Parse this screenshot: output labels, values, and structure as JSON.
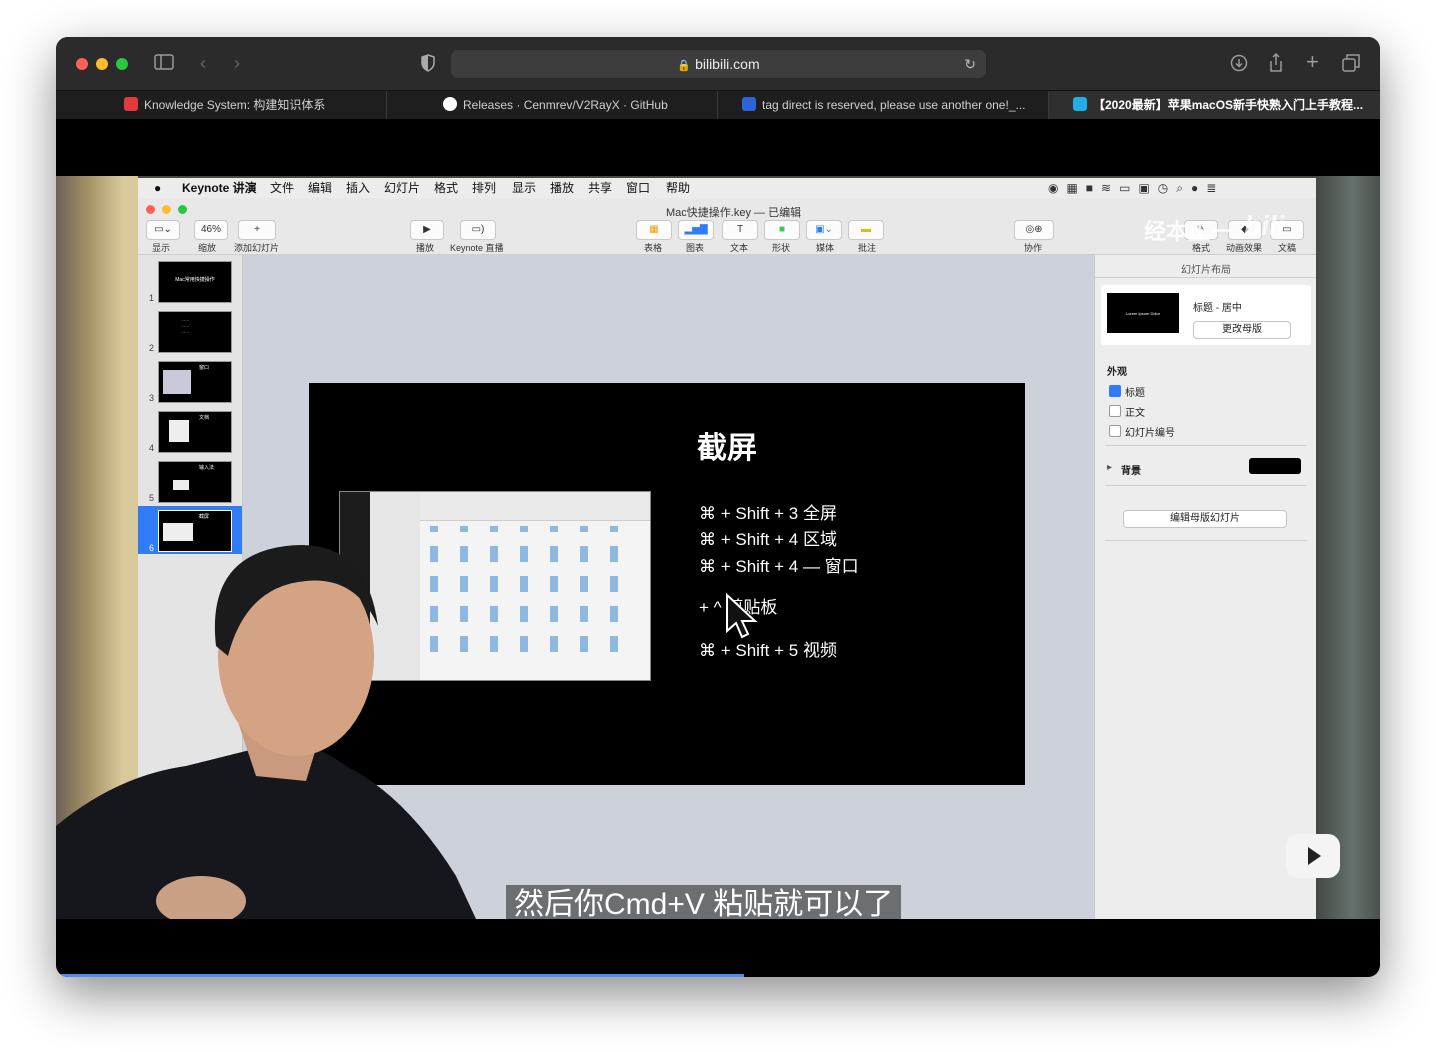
{
  "browser": {
    "url": "bilibili.com",
    "tabs": [
      {
        "label": "Knowledge System: 构建知识体系",
        "favicon_color": "#e23a3a"
      },
      {
        "label": "Releases · Cenmrev/V2RayX · GitHub",
        "favicon_color": "#ffffff"
      },
      {
        "label": "tag direct is reserved, please use another one!_...",
        "favicon_color": "#2f63d8"
      },
      {
        "label": "【2020最新】苹果macOS新手快熟入门上手教程...",
        "favicon_color": "#23ade5"
      }
    ]
  },
  "mac_menubar": {
    "app": "Keynote 讲演",
    "items": [
      "文件",
      "编辑",
      "插入",
      "幻灯片",
      "格式",
      "排列",
      "显示",
      "播放",
      "共享",
      "窗口",
      "帮助"
    ]
  },
  "keynote": {
    "doc_title": "Mac快捷操作.key — 已编辑",
    "zoom": "46%",
    "toolbar_labels": {
      "view": "显示",
      "zoom": "缩放",
      "add_slide": "添加幻灯片",
      "play": "播放",
      "live": "Keynote 直播",
      "table": "表格",
      "chart": "图表",
      "text": "文本",
      "shape": "形状",
      "media": "媒体",
      "comment": "批注",
      "collaborate": "协作",
      "format": "格式",
      "animate": "动画效果",
      "document": "文稿"
    },
    "slide_numbers": [
      "1",
      "2",
      "3",
      "4",
      "5",
      "6"
    ],
    "thumb_titles": [
      "Mac常用快捷操作",
      "",
      "窗口",
      "文档",
      "输入法",
      "截屏"
    ],
    "inspector": {
      "header": "幻灯片布局",
      "layout_name": "标题 - 居中",
      "layout_preview": "Lorem Ipsum Dolor",
      "change_master": "更改母版",
      "appearance": "外观",
      "checkboxes": [
        {
          "label": "标题",
          "checked": true
        },
        {
          "label": "正文",
          "checked": false
        },
        {
          "label": "幻灯片编号",
          "checked": false
        }
      ],
      "background": "背景",
      "edit_master": "编辑母版幻灯片"
    },
    "slide": {
      "title": "截屏",
      "lines": [
        "⌘ + Shift + 3  全屏",
        "⌘ + Shift + 4 区域",
        "⌘ + Shift + 4 —  窗口",
        "+ ^ 剪贴板",
        "⌘ + Shift + 5  视频"
      ]
    }
  },
  "watermark": "经本正一",
  "subtitle": "然后你Cmd+V 粘贴就可以了",
  "progress": 0.52
}
